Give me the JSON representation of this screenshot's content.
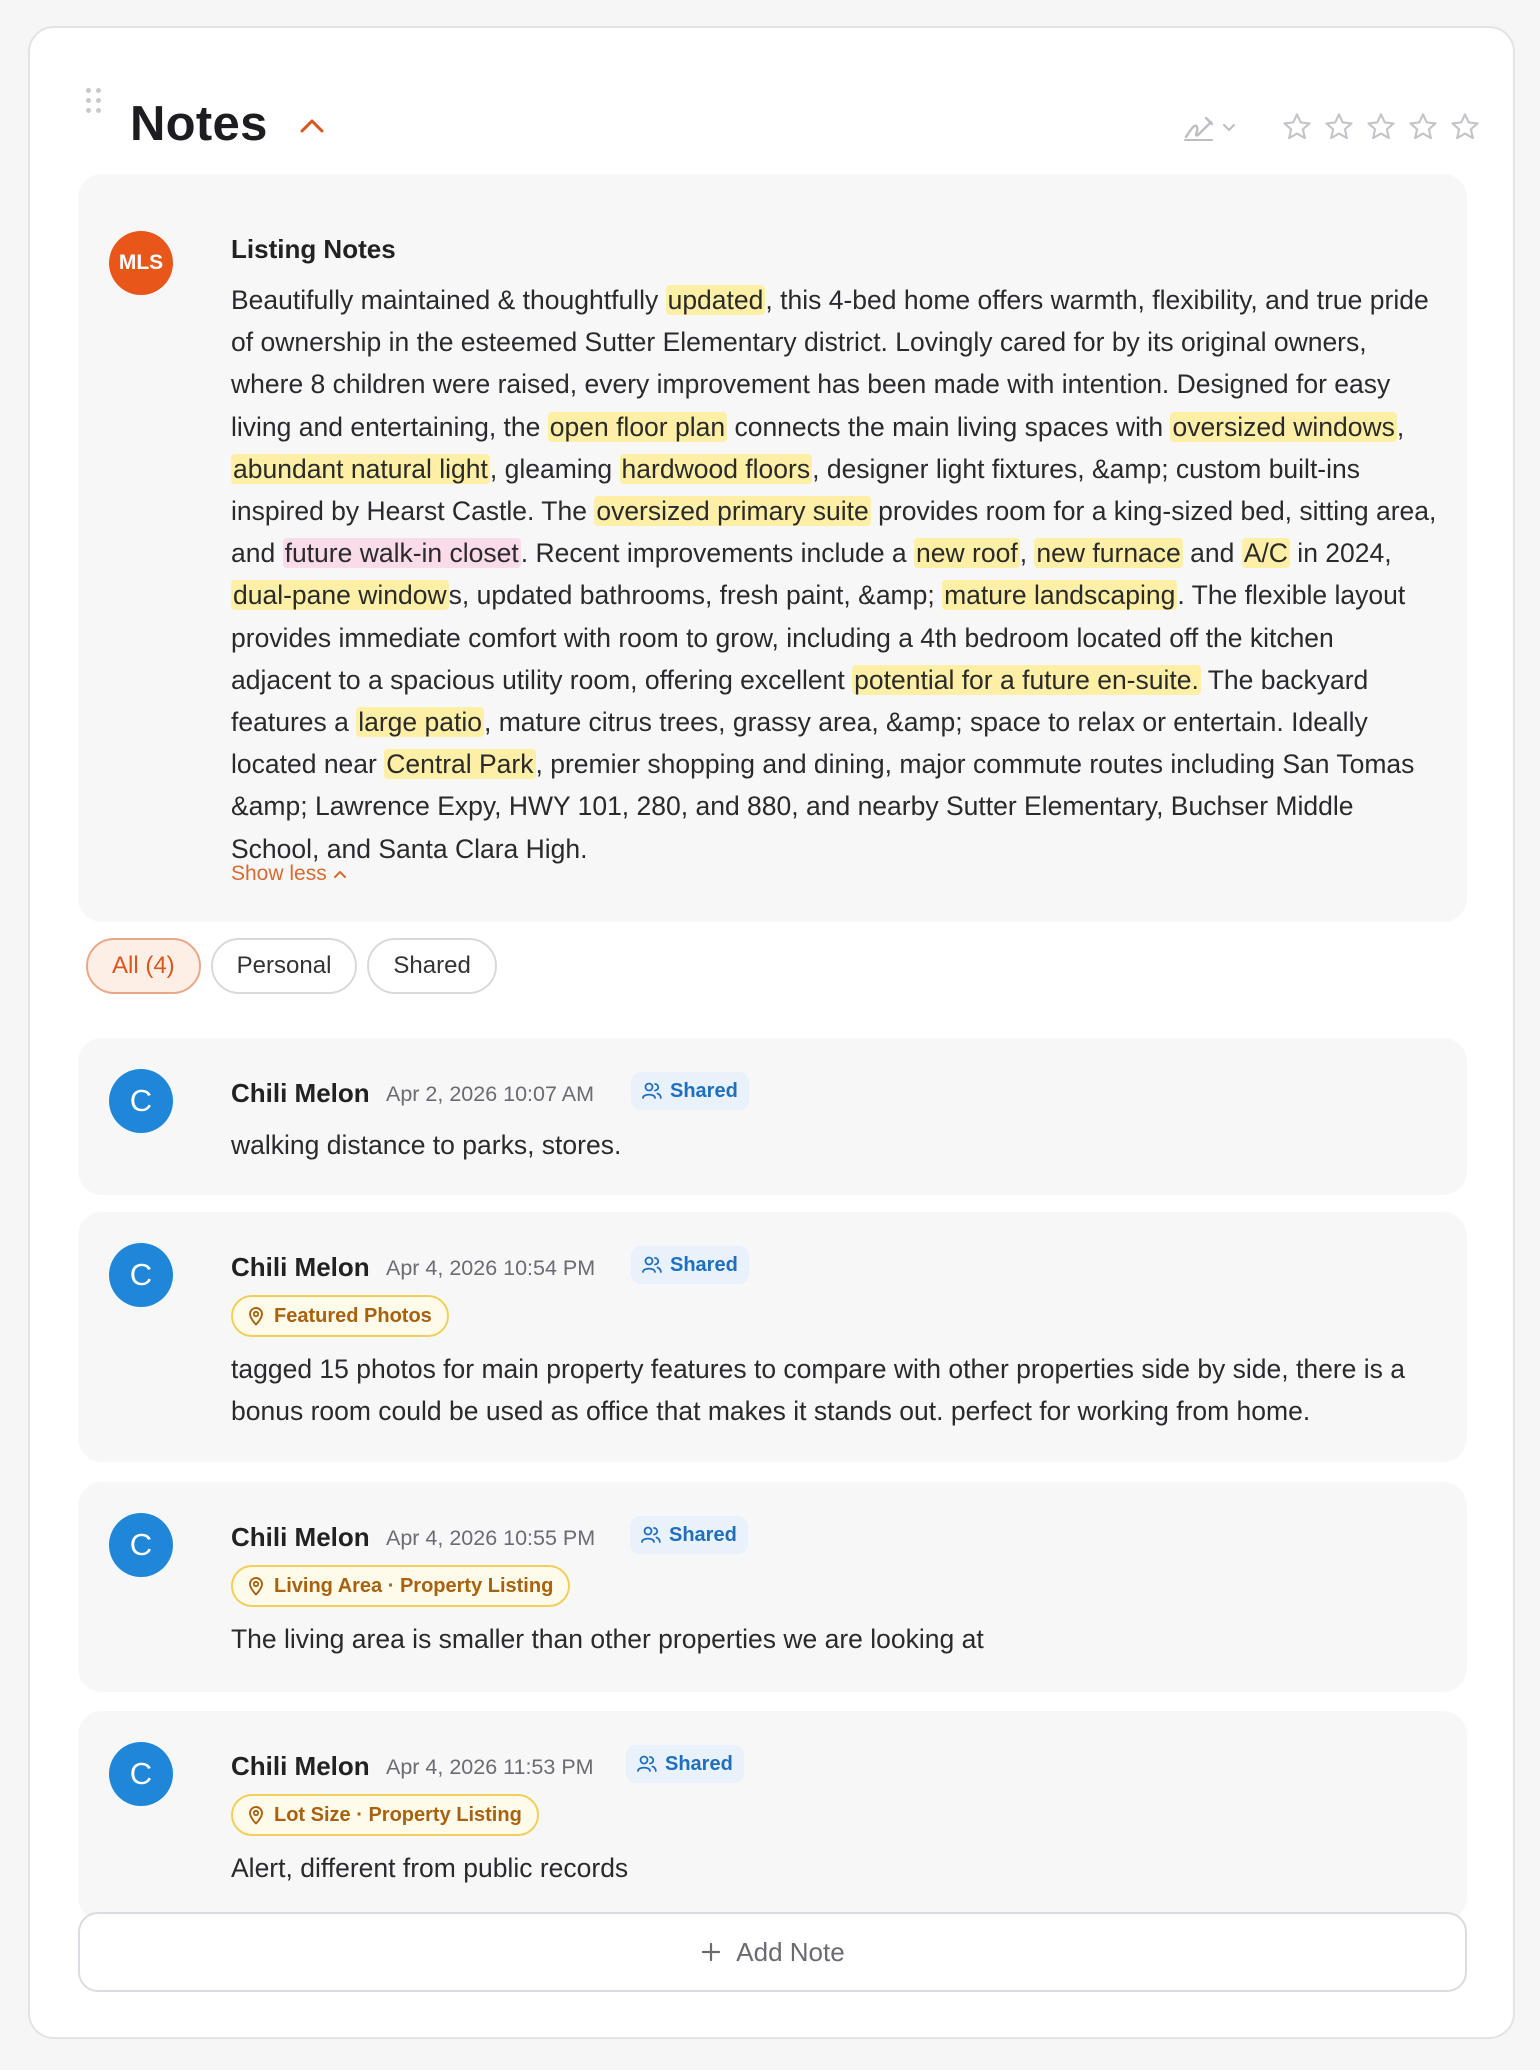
{
  "header": {
    "title": "Notes"
  },
  "listing": {
    "avatar": "MLS",
    "title": "Listing Notes",
    "show_less": "Show less",
    "segments": [
      {
        "t": "Beautifully maintained & thoughtfully "
      },
      {
        "t": "updated",
        "h": "y"
      },
      {
        "t": ", this 4-bed home offers warmth, flexibility, and true pride of ownership in the esteemed Sutter Elementary district. Lovingly cared for by its original owners, where 8 children were raised, every improvement has been made with intention. Designed for easy living and entertaining, the "
      },
      {
        "t": "open floor plan",
        "h": "y"
      },
      {
        "t": " connects the main living spaces with "
      },
      {
        "t": "oversized windows",
        "h": "y"
      },
      {
        "t": ", "
      },
      {
        "t": "abundant natural light",
        "h": "y"
      },
      {
        "t": ", gleaming "
      },
      {
        "t": "hardwood floors",
        "h": "y"
      },
      {
        "t": ", designer light fixtures, &amp; custom built-ins inspired by Hearst Castle. The "
      },
      {
        "t": "oversized primary suite",
        "h": "y"
      },
      {
        "t": " provides room for a king-sized bed, sitting area, and "
      },
      {
        "t": "future walk-in closet",
        "h": "p"
      },
      {
        "t": ". Recent improvements include a "
      },
      {
        "t": "new roof",
        "h": "y"
      },
      {
        "t": ", "
      },
      {
        "t": "new furnace",
        "h": "y"
      },
      {
        "t": " and "
      },
      {
        "t": "A/C",
        "h": "y"
      },
      {
        "t": " in 2024, "
      },
      {
        "t": "dual-pane window",
        "h": "y"
      },
      {
        "t": "s, updated bathrooms, fresh paint, &amp; "
      },
      {
        "t": "mature landscaping",
        "h": "y"
      },
      {
        "t": ". The flexible layout provides immediate comfort with room to grow, including a 4th bedroom located off the kitchen adjacent to a spacious utility room, offering excellent "
      },
      {
        "t": "potential for a future en-suite.",
        "h": "y"
      },
      {
        "t": " The backyard features a "
      },
      {
        "t": "large patio",
        "h": "y"
      },
      {
        "t": ", mature citrus trees, grassy area, &amp; space to relax or entertain. Ideally located near "
      },
      {
        "t": "Central Park",
        "h": "y"
      },
      {
        "t": ", premier shopping and dining, major commute routes including San Tomas &amp; Lawrence Expy, HWY 101, 280, and 880, and nearby Sutter Elementary, Buchser Middle School, and Santa Clara High."
      }
    ]
  },
  "filters": {
    "all": "All (4)",
    "personal": "Personal",
    "shared": "Shared"
  },
  "notes": [
    {
      "avatar": "C",
      "author": "Chili Melon",
      "time": "Apr 2, 2026 10:07 AM",
      "badge": "Shared",
      "text": "walking distance to parks, stores."
    },
    {
      "avatar": "C",
      "author": "Chili Melon",
      "time": "Apr 4, 2026 10:54 PM",
      "badge": "Shared",
      "tag": "Featured Photos",
      "text": "tagged 15 photos for main property features to compare with other properties side by side, there is a bonus room could be used as office that makes it stands out. perfect for working from home."
    },
    {
      "avatar": "C",
      "author": "Chili Melon",
      "time": "Apr 4, 2026 10:55 PM",
      "badge": "Shared",
      "tag": "Living Area · Property Listing",
      "text": "The living area is smaller than other properties we are looking at"
    },
    {
      "avatar": "C",
      "author": "Chili Melon",
      "time": "Apr 4, 2026 11:53 PM",
      "badge": "Shared",
      "tag": "Lot Size · Property Listing",
      "text": "Alert, different from public records"
    }
  ],
  "add_note": "Add Note",
  "colors": {
    "accent": "#d9571d",
    "mls_avatar": "#e8561a",
    "user_avatar": "#1f86d8",
    "highlight_yellow": "#fdf0a6",
    "highlight_pink": "#fadbe8",
    "shared_badge": "#1f6fbf"
  },
  "icons": {
    "drag": "drag-handle-icon",
    "collapse": "chevron-up-icon",
    "sign": "signature-icon",
    "rating": "star-outline-icon",
    "shared": "users-icon",
    "tag": "map-pin-icon",
    "add": "plus-icon"
  }
}
